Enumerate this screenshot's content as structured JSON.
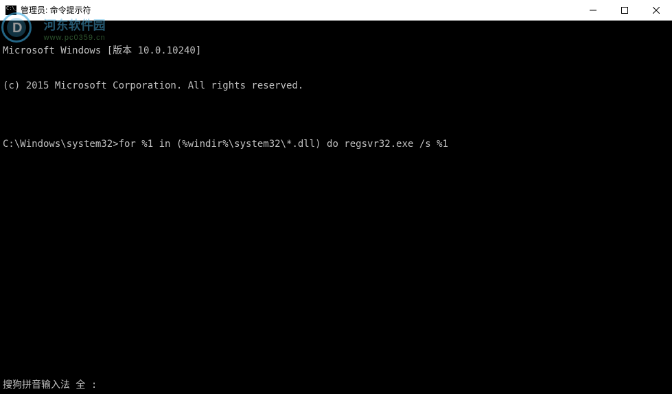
{
  "titlebar": {
    "title": "管理员: 命令提示符"
  },
  "terminal": {
    "line1": "Microsoft Windows [版本 10.0.10240]",
    "line2": "(c) 2015 Microsoft Corporation. All rights reserved.",
    "line3": "",
    "prompt": "C:\\Windows\\system32>",
    "command": "for %1 in (%windir%\\system32\\*.dll) do regsvr32.exe /s %1"
  },
  "ime": {
    "status": "搜狗拼音输入法 全 :"
  },
  "watermark": {
    "cn_text": "河东软件园",
    "url_text": "www.pc0359.cn"
  }
}
